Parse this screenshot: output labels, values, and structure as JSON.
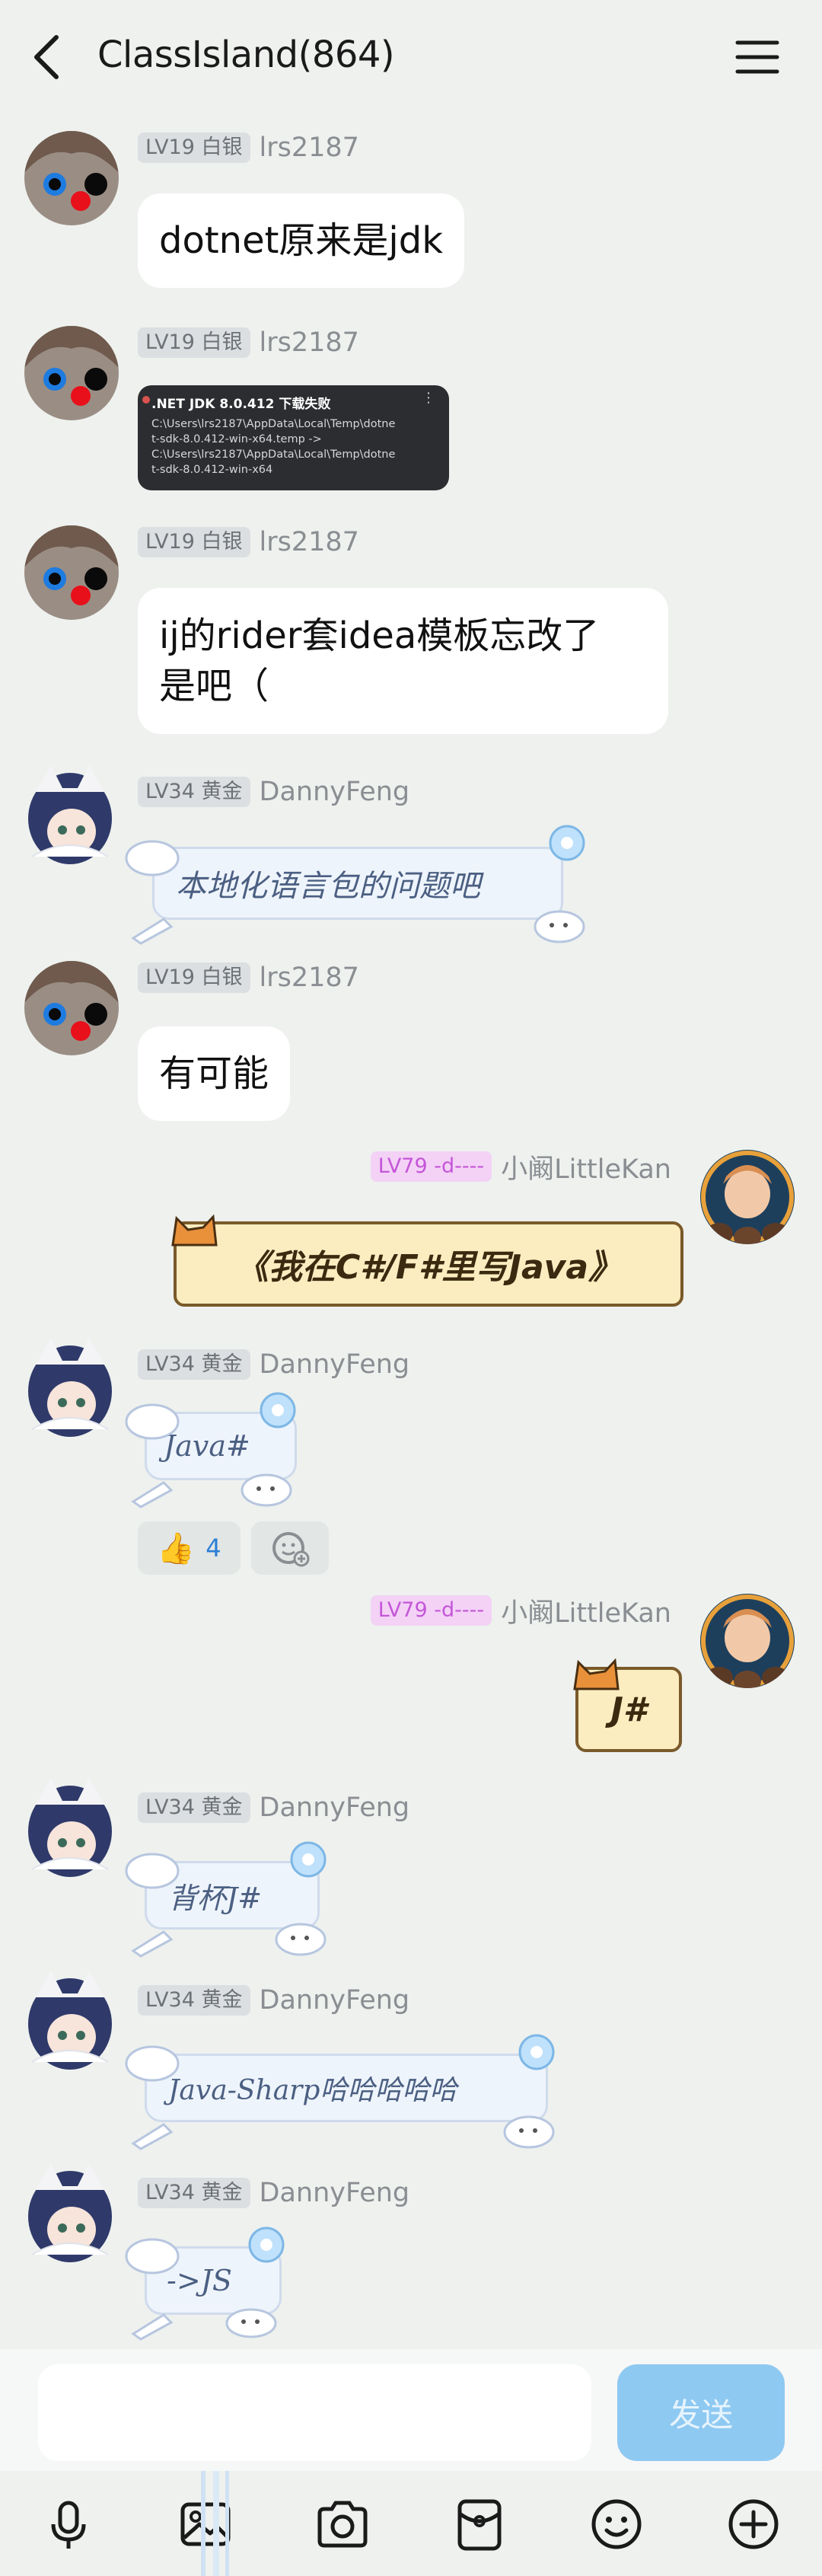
{
  "header": {
    "title": "ClassIsland(864)"
  },
  "messages": [
    {
      "badge": "LV19 白银",
      "user": "lrs2187",
      "text": "dotnet原来是jdk"
    },
    {
      "badge": "LV19 白银",
      "user": "lrs2187",
      "image": {
        "title": ".NET JDK 8.0.412 下载失败",
        "lines": [
          "C:\\Users\\lrs2187\\AppData\\Local\\Temp\\dotne",
          "t-sdk-8.0.412-win-x64.temp ->",
          "C:\\Users\\lrs2187\\AppData\\Local\\Temp\\dotne",
          "t-sdk-8.0.412-win-x64"
        ]
      }
    },
    {
      "badge": "LV19 白银",
      "user": "lrs2187",
      "text_line1": "ij的rider套idea模板忘改了",
      "text_line2": "是吧（"
    },
    {
      "badge": "LV34 黄金",
      "user": "DannyFeng",
      "text": "本地化语言包的问题吧"
    },
    {
      "badge": "LV19 白银",
      "user": "lrs2187",
      "text": "有可能"
    },
    {
      "badge": "LV79 -d----",
      "user": "小阚LittleKan",
      "text": "《我在C#/F#里写Java》"
    },
    {
      "badge": "LV34 黄金",
      "user": "DannyFeng",
      "text": "Java#",
      "reaction_count": "4"
    },
    {
      "badge": "LV79 -d----",
      "user": "小阚LittleKan",
      "text": "J#"
    },
    {
      "badge": "LV34 黄金",
      "user": "DannyFeng",
      "text": "背杯J#"
    },
    {
      "badge": "LV34 黄金",
      "user": "DannyFeng",
      "text": "Java-Sharp哈哈哈哈哈"
    },
    {
      "badge": "LV34 黄金",
      "user": "DannyFeng",
      "text": "->JS"
    }
  ],
  "input": {
    "send_label": "发送"
  },
  "toolbar": [
    "microphone-icon",
    "image-icon",
    "camera-icon",
    "red-packet-icon",
    "emoji-icon",
    "plus-icon"
  ],
  "colors": {
    "background": "#eef1ee",
    "send_button": "#8ec9f2",
    "bubble": "#ffffff"
  }
}
